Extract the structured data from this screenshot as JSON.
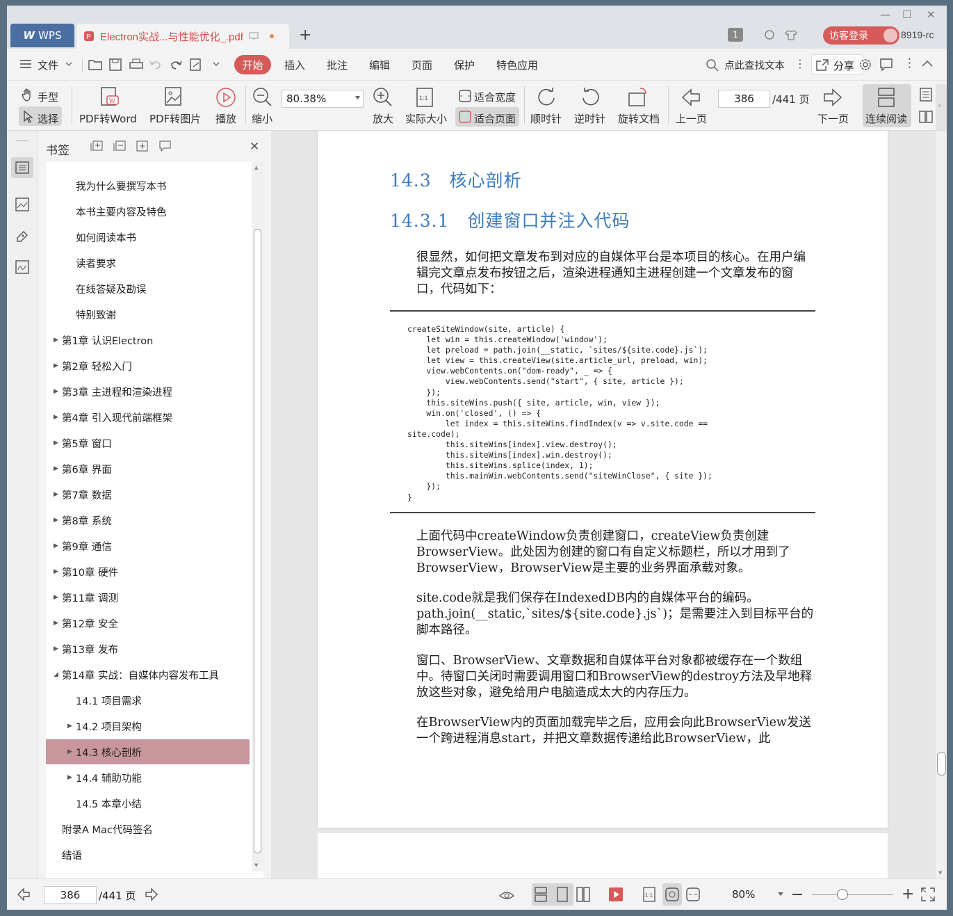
{
  "titlebar": {
    "app": "WPS",
    "tab_title": "Electron实战...与性能优化_.pdf",
    "tab_count": "1",
    "login": "访客登录",
    "user": "8919-rc"
  },
  "menu": {
    "file": "文件",
    "items": [
      "开始",
      "插入",
      "批注",
      "编辑",
      "页面",
      "保护",
      "特色应用"
    ],
    "search": "点此查找文本",
    "share": "分享"
  },
  "ribbon": {
    "hand": "手型",
    "select": "选择",
    "pdf2word": "PDF转Word",
    "pdf2img": "PDF转图片",
    "play": "播放",
    "zoom_out": "缩小",
    "zoom_value": "80.38%",
    "zoom_in": "放大",
    "actual_size": "实际大小",
    "fit_width": "适合宽度",
    "fit_page": "适合页面",
    "clockwise": "顺时针",
    "counter_clockwise": "逆时针",
    "rotate_doc": "旋转文档",
    "prev_page": "上一页",
    "page_num": "386",
    "page_total": "/441 页",
    "next_page": "下一页",
    "continuous": "连续阅读"
  },
  "bookmarks": {
    "title": "书签",
    "items": [
      {
        "label": "我为什么要撰写本书",
        "level": 2,
        "arrow": ""
      },
      {
        "label": "本书主要内容及特色",
        "level": 2,
        "arrow": ""
      },
      {
        "label": "如何阅读本书",
        "level": 2,
        "arrow": ""
      },
      {
        "label": "读者要求",
        "level": 2,
        "arrow": ""
      },
      {
        "label": "在线答疑及勘误",
        "level": 2,
        "arrow": ""
      },
      {
        "label": "特别致谢",
        "level": 2,
        "arrow": ""
      },
      {
        "label": "第1章 认识Electron",
        "level": 1,
        "arrow": "▶"
      },
      {
        "label": "第2章 轻松入门",
        "level": 1,
        "arrow": "▶"
      },
      {
        "label": "第3章 主进程和渲染进程",
        "level": 1,
        "arrow": "▶"
      },
      {
        "label": "第4章 引入现代前端框架",
        "level": 1,
        "arrow": "▶"
      },
      {
        "label": "第5章 窗口",
        "level": 1,
        "arrow": "▶"
      },
      {
        "label": "第6章 界面",
        "level": 1,
        "arrow": "▶"
      },
      {
        "label": "第7章 数据",
        "level": 1,
        "arrow": "▶"
      },
      {
        "label": "第8章 系统",
        "level": 1,
        "arrow": "▶"
      },
      {
        "label": "第9章 通信",
        "level": 1,
        "arrow": "▶"
      },
      {
        "label": "第10章 硬件",
        "level": 1,
        "arrow": "▶"
      },
      {
        "label": "第11章 调测",
        "level": 1,
        "arrow": "▶"
      },
      {
        "label": "第12章 安全",
        "level": 1,
        "arrow": "▶"
      },
      {
        "label": "第13章 发布",
        "level": 1,
        "arrow": "▶"
      },
      {
        "label": "第14章 实战：自媒体内容发布工具",
        "level": 1,
        "arrow": "◢"
      },
      {
        "label": "14.1 项目需求",
        "level": 2,
        "arrow": ""
      },
      {
        "label": "14.2 项目架构",
        "level": 2,
        "arrow": "▶"
      },
      {
        "label": "14.3 核心剖析",
        "level": 2,
        "arrow": "▶",
        "selected": true
      },
      {
        "label": "14.4 辅助功能",
        "level": 2,
        "arrow": "▶"
      },
      {
        "label": "14.5 本章小结",
        "level": 2,
        "arrow": ""
      },
      {
        "label": "附录A Mac代码签名",
        "level": 1,
        "arrow": ""
      },
      {
        "label": "结语",
        "level": 1,
        "arrow": ""
      }
    ]
  },
  "document": {
    "heading1": "14.3　核心剖析",
    "heading2": "14.3.1　创建窗口并注入代码",
    "para1": "很显然，如何把文章发布到对应的自媒体平台是本项目的核心。在用户编辑完文章点发布按钮之后，渲染进程通知主进程创建一个文章发布的窗口，代码如下：",
    "code": "createSiteWindow(site, article) {\n    let win = this.createWindow('window');\n    let preload = path.join(__static, `sites/${site.code}.js`);\n    let view = this.createView(site.article_url, preload, win);\n    view.webContents.on(\"dom-ready\", _ => {\n        view.webContents.send(\"start\", { site, article });\n    });\n    this.siteWins.push({ site, article, win, view });\n    win.on('closed', () => {\n        let index = this.siteWins.findIndex(v => v.site.code ==\nsite.code);\n        this.siteWins[index].view.destroy();\n        this.siteWins[index].win.destroy();\n        this.siteWins.splice(index, 1);\n        this.mainWin.webContents.send(\"siteWinClose\", { site });\n    });\n}",
    "para2": "上面代码中createWindow负责创建窗口，createView负责创建BrowserView。此处因为创建的窗口有自定义标题栏，所以才用到了BrowserView，BrowserView是主要的业务界面承载对象。",
    "para3": "site.code就是我们保存在IndexedDB内的自媒体平台的编码。path.join(__static,`sites/${site.code}.js`)；是需要注入到目标平台的脚本路径。",
    "para4": "窗口、BrowserView、文章数据和自媒体平台对象都被缓存在一个数组中。待窗口关闭时需要调用窗口和BrowserView的destroy方法及早地释放这些对象，避免给用户电脑造成太大的内存压力。",
    "para5": "在BrowserView内的页面加载完毕之后，应用会向此BrowserView发送一个跨进程消息start，并把文章数据传递给此BrowserView，此"
  },
  "statusbar": {
    "page_num": "386",
    "page_total": "/441 页",
    "zoom": "80%",
    "zoom_slider_fraction": 0.38
  },
  "colors": {
    "accent": "#d65a5a",
    "heading": "#3b7bbf",
    "selected_bookmark": "#c9969d",
    "wps_tab": "#4a6fa0"
  }
}
